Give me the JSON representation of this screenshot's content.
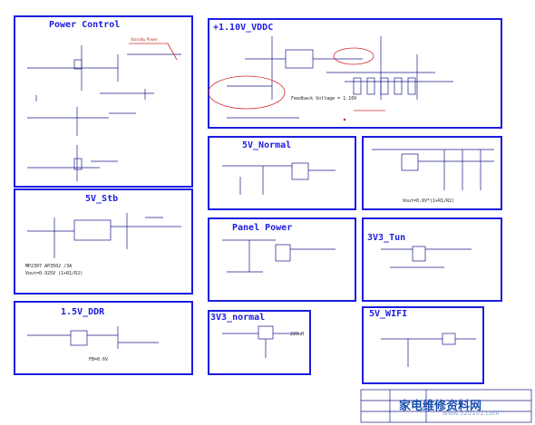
{
  "blocks": {
    "power_control": {
      "title": "Power Control",
      "note": "Standby Power"
    },
    "vddc": {
      "title": "+1.10V_VDDC",
      "note": "Feedback Voltage = 1.10V"
    },
    "stb5v": {
      "title": "5V_Stb",
      "note1": "MP2307 AP3502 /3A",
      "note2": "Vout=0.925V (1+R1/R2)"
    },
    "normal5v": {
      "title": "5V_Normal"
    },
    "right_top": {
      "note": "Vout=0.6V*(1+R1/R2)"
    },
    "panel_power": {
      "title": "Panel Power"
    },
    "tun3v3": {
      "title": "3V3_Tun"
    },
    "ddr": {
      "title": "1.5V_DDR",
      "note": "FB=0.6V"
    },
    "normal3v3": {
      "title": "3V3_normal",
      "note": "220uH"
    },
    "wifi": {
      "title": "5V_WIFI"
    }
  },
  "watermark": {
    "text": "家电维修资料网",
    "url": "www.520101.com"
  },
  "colors": {
    "frame": "#1c1ce0",
    "wire": "#1a1a8a",
    "annotation": "#d12b2b"
  }
}
